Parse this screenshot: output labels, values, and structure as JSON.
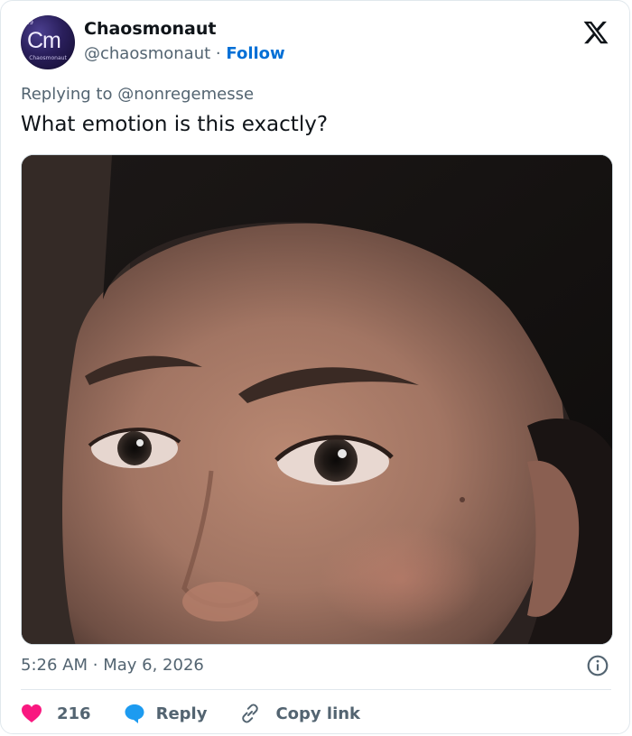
{
  "author": {
    "display_name": "Chaosmonaut",
    "handle": "@chaosmonaut",
    "separator": "·",
    "follow_label": "Follow",
    "avatar": {
      "atomic_number": "19",
      "symbol": "Cm",
      "caption": "Chaosmonaut"
    }
  },
  "platform_icon": "x-logo-icon",
  "tweet": {
    "replying_prefix": "Replying to",
    "replying_to": "@nonregemesse",
    "text": "What emotion is this exactly?",
    "time": "5:26 AM",
    "date_separator": "·",
    "date": "May 6, 2026"
  },
  "actions": {
    "like_count": "216",
    "reply_label": "Reply",
    "copy_link_label": "Copy link"
  },
  "colors": {
    "like": "#f91880",
    "reply": "#1d9bf0",
    "link": "#006fd6",
    "muted": "#536471"
  },
  "icons": [
    "heart-icon",
    "speech-bubble-icon",
    "link-icon",
    "info-icon"
  ]
}
